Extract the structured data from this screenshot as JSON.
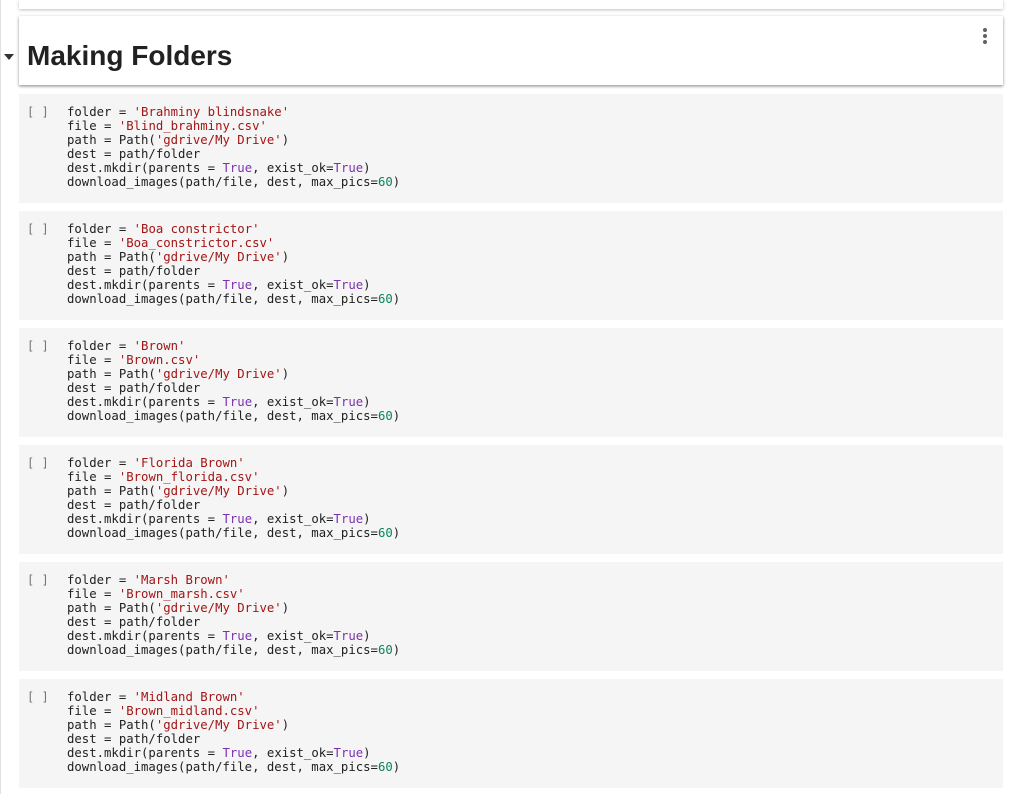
{
  "section": {
    "title": "Making Folders"
  },
  "cells": [
    {
      "run_label": "[ ]",
      "folder": "'Brahminy blindsnake'",
      "file": "'Blind_brahminy.csv'"
    },
    {
      "run_label": "[ ]",
      "folder": "'Boa constrictor'",
      "file": "'Boa_constrictor.csv'"
    },
    {
      "run_label": "[ ]",
      "folder": "'Brown'",
      "file": "'Brown.csv'"
    },
    {
      "run_label": "[ ]",
      "folder": "'Florida Brown'",
      "file": "'Brown_florida.csv'"
    },
    {
      "run_label": "[ ]",
      "folder": "'Marsh Brown'",
      "file": "'Brown_marsh.csv'"
    },
    {
      "run_label": "[ ]",
      "folder": "'Midland Brown'",
      "file": "'Brown_midland.csv'"
    }
  ],
  "code": {
    "folder_assign": "folder = ",
    "file_assign": "file = ",
    "path_prefix": "path = Path(",
    "path_arg": "'gdrive/My Drive'",
    "path_suffix": ")",
    "dest_line": "dest = path/folder",
    "mkdir_prefix": "dest.mkdir(parents = ",
    "mkdir_true1": "True",
    "mkdir_mid": ", exist_ok=",
    "mkdir_true2": "True",
    "mkdir_suffix": ")",
    "download_prefix": "download_images(path/file, dest, max_pics=",
    "download_num": "60",
    "download_suffix": ")"
  },
  "icons": {
    "collapse": "caret-down-icon",
    "menu": "more-vert-icon"
  },
  "colors": {
    "string": "#a31515",
    "keyword": "#7b30b0",
    "number": "#098658",
    "cell_bg": "#f5f5f5"
  }
}
